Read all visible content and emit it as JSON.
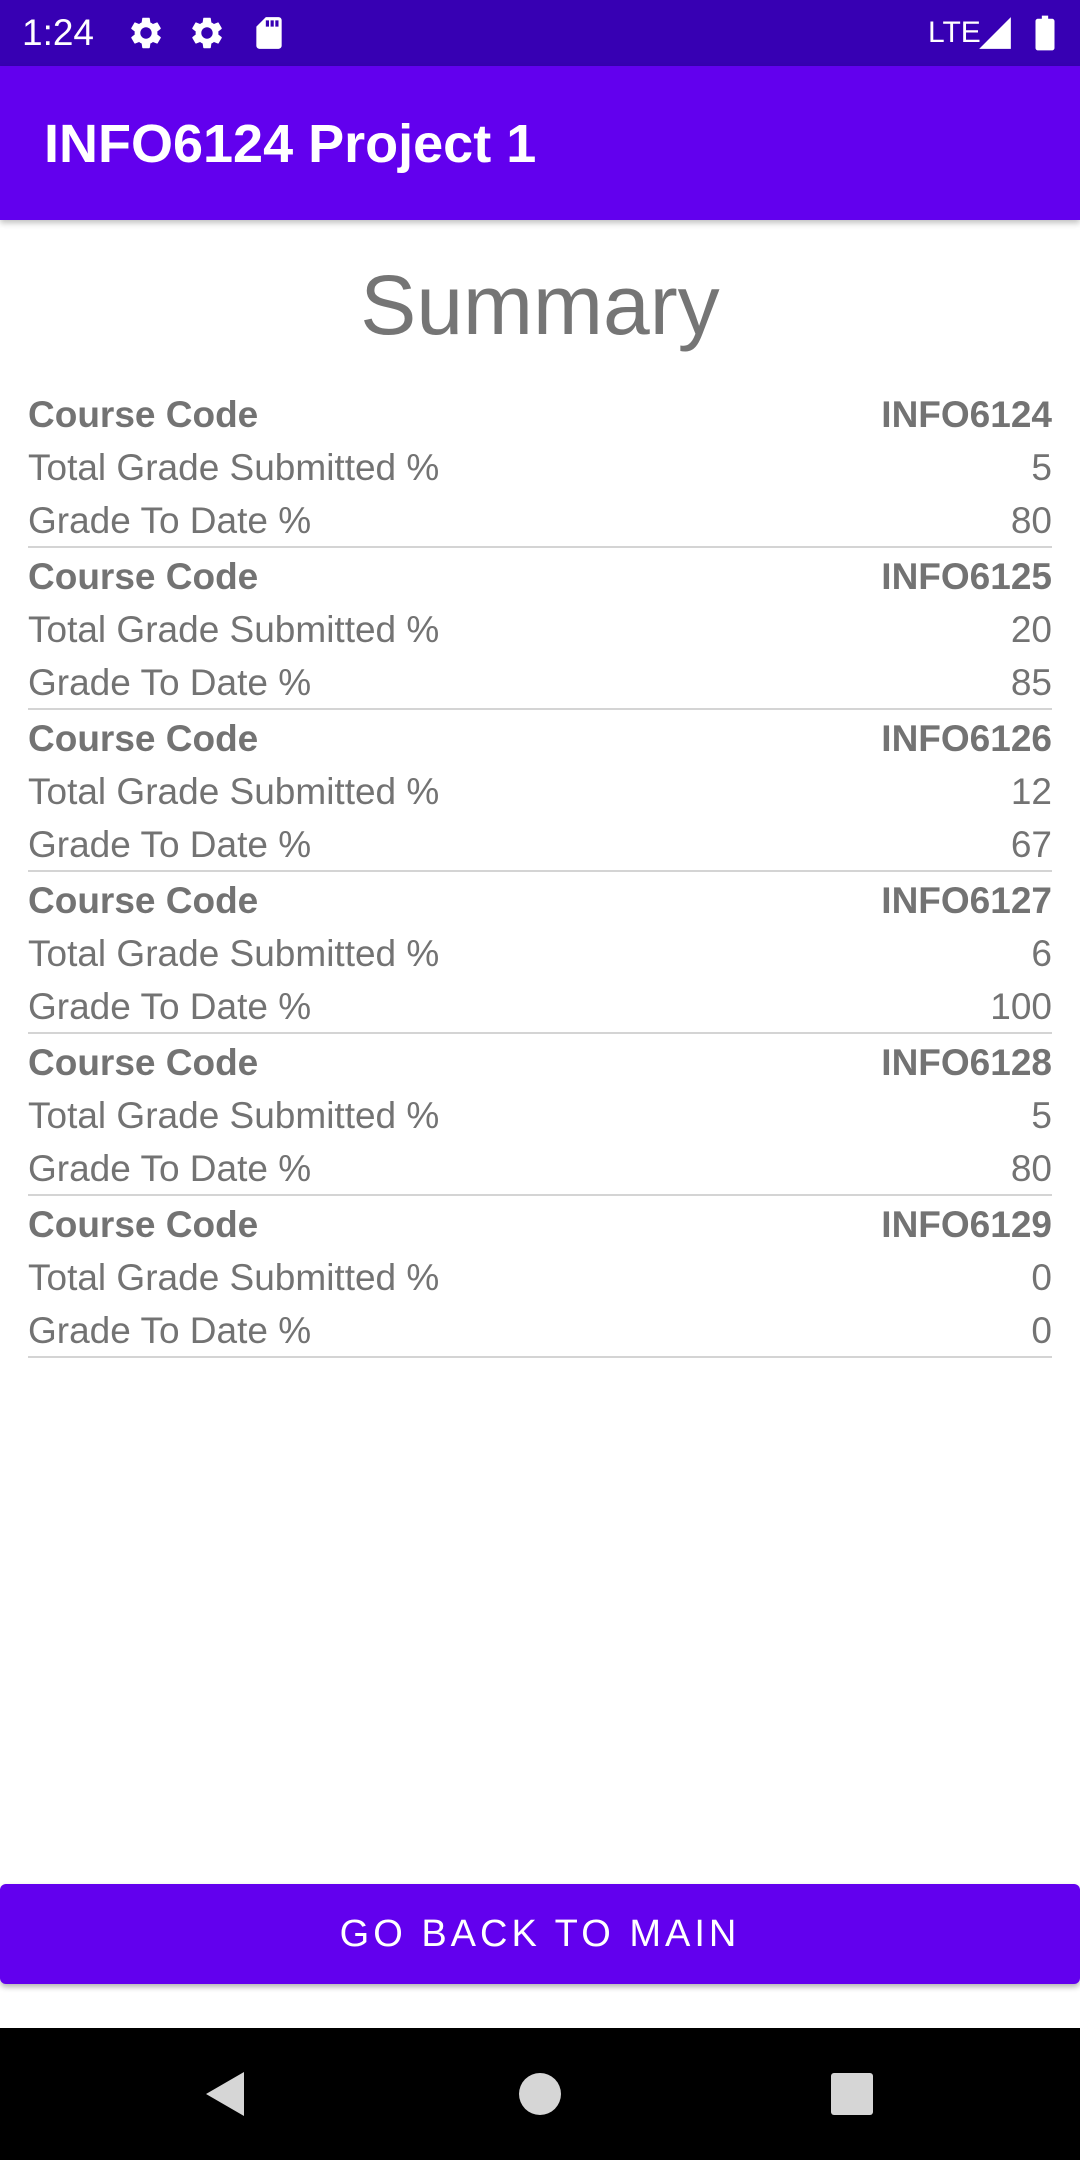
{
  "status_bar": {
    "time": "1:24",
    "network": "LTE",
    "icons": [
      "gear-icon",
      "gear-icon",
      "sd-card-icon",
      "signal-icon",
      "battery-icon"
    ]
  },
  "app_bar": {
    "title": "INFO6124 Project 1"
  },
  "summary": {
    "title": "Summary",
    "labels": {
      "course_code": "Course Code",
      "total_submitted": "Total Grade Submitted %",
      "grade_to_date": "Grade To Date %"
    },
    "courses": [
      {
        "code": "INFO6124",
        "total_submitted": "5",
        "grade_to_date": "80"
      },
      {
        "code": "INFO6125",
        "total_submitted": "20",
        "grade_to_date": "85"
      },
      {
        "code": "INFO6126",
        "total_submitted": "12",
        "grade_to_date": "67"
      },
      {
        "code": "INFO6127",
        "total_submitted": "6",
        "grade_to_date": "100"
      },
      {
        "code": "INFO6128",
        "total_submitted": "5",
        "grade_to_date": "80"
      },
      {
        "code": "INFO6129",
        "total_submitted": "0",
        "grade_to_date": "0"
      }
    ]
  },
  "button": {
    "label": "GO BACK TO MAIN"
  },
  "nav_bar": {
    "icons": [
      "back-icon",
      "home-icon",
      "recents-icon"
    ]
  },
  "colors": {
    "status_bar": "#3700b3",
    "primary": "#6200ee",
    "text_gray": "#737373",
    "divider": "#d4d4d4"
  }
}
